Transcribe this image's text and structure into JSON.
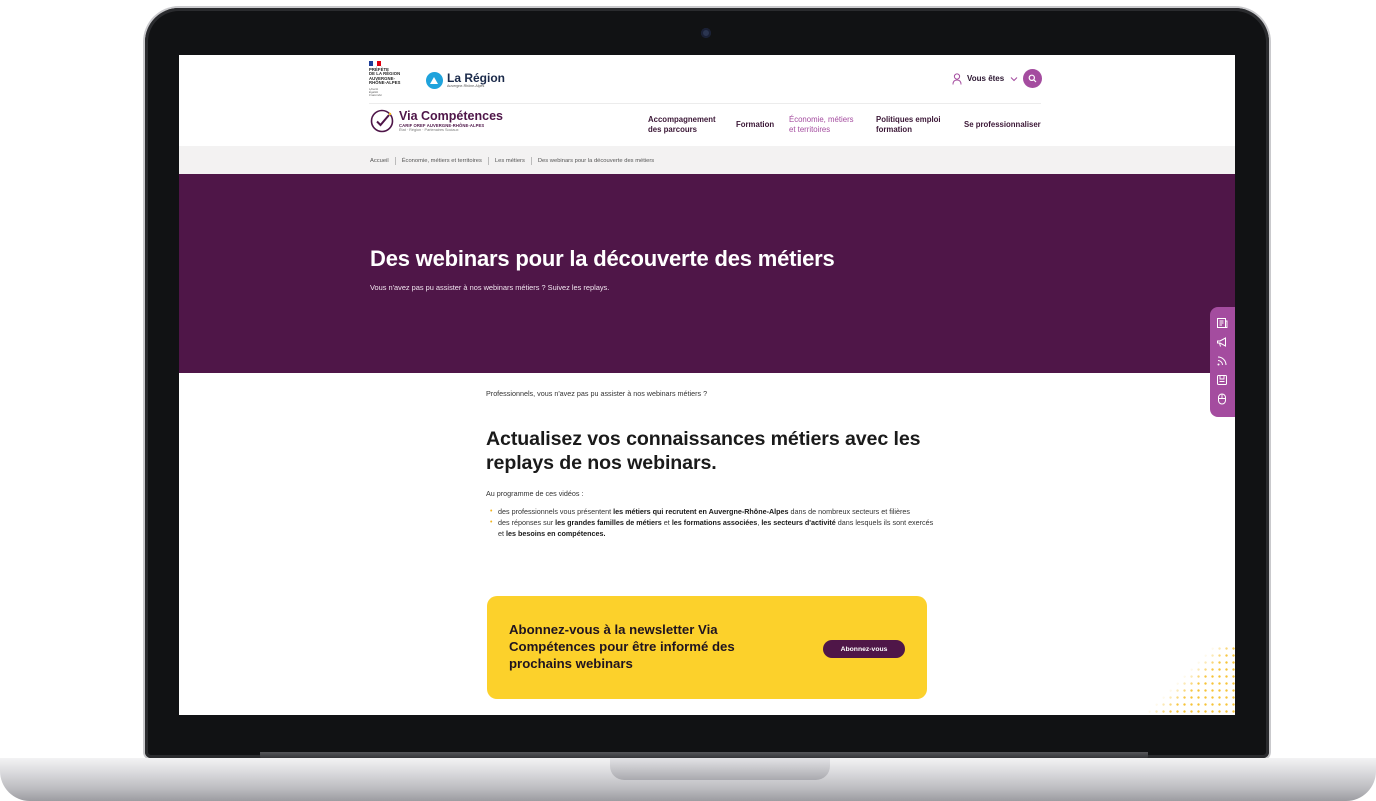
{
  "gov": {
    "lines": [
      "PRÉFÈTE",
      "DE LA RÉGION",
      "AUVERGNE-",
      "RHÔNE-ALPES"
    ],
    "motto": [
      "Liberté",
      "Égalité",
      "Fraternité"
    ]
  },
  "region": {
    "title": "La Région",
    "sub": "Auvergne-Rhône-Alpes"
  },
  "header": {
    "vous_etes": "Vous êtes"
  },
  "via": {
    "title": "Via Compétences",
    "sub1": "CARIF OREF AUVERGNE-RHÔNE-ALPES",
    "sub2": "État · Région · Partenaires Sociaux"
  },
  "nav": {
    "items": [
      {
        "line1": "Accompagnement",
        "line2": "des parcours"
      },
      {
        "line1": "Formation",
        "line2": ""
      },
      {
        "line1": "Économie, métiers",
        "line2": "et territoires"
      },
      {
        "line1": "Politiques emploi",
        "line2": "formation"
      },
      {
        "line1": "Se professionnaliser",
        "line2": ""
      }
    ]
  },
  "breadcrumb": [
    "Accueil",
    "Économie, métiers et territoires",
    "Les métiers",
    "Des webinars pour la découverte des métiers"
  ],
  "hero": {
    "title": "Des webinars pour la découverte des métiers",
    "subtitle": "Vous n'avez pas pu assister à nos webinars métiers ? Suivez les replays."
  },
  "side_tools": [
    "newspaper-icon",
    "megaphone-icon",
    "rss-icon",
    "agenda-icon",
    "mouse-icon"
  ],
  "content": {
    "intro": "Professionnels, vous n'avez pas pu assister à nos webinars métiers ?",
    "heading": "Actualisez vos connaissances métiers avec les replays de nos webinars.",
    "programme": "Au programme de ces vidéos :",
    "bullet1": {
      "t1": "des professionnels vous présentent ",
      "b1": "les métiers qui recrutent en Auvergne-Rhône-Alpes",
      "t2": " dans de nombreux secteurs et filières"
    },
    "bullet2": {
      "t1": "des réponses sur ",
      "b1": "les grandes familles de métiers",
      "t2": " et ",
      "b2": "les formations associées",
      "t3": ", ",
      "b3": "les secteurs d'activité",
      "t4": " dans lesquels ils sont exercés et ",
      "b4": "les besoins en compétences."
    }
  },
  "newsletter": {
    "text": "Abonnez-vous à la newsletter Via Compétences pour être informé des prochains webinars",
    "button": "Abonnez-vous"
  },
  "colors": {
    "brand": "#4f1648",
    "accent": "#a44c9f",
    "yellow": "#fcd12b"
  }
}
